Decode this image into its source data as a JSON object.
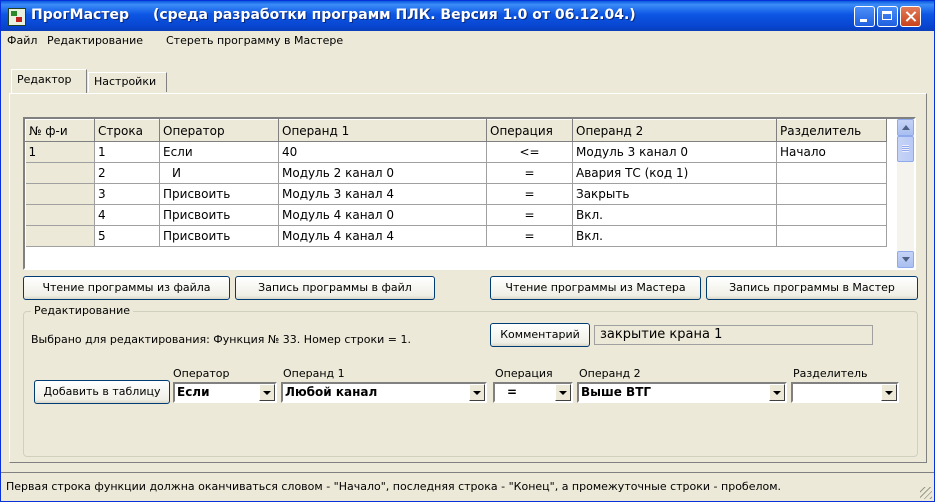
{
  "window": {
    "title": "ПрогМастер",
    "subtitle": "(среда разработки программ ПЛК.   Версия 1.0 от 06.12.04.)"
  },
  "menu": [
    "Файл",
    "Редактирование",
    "Стереть программу в Мастере"
  ],
  "tabs": [
    {
      "label": "Редактор",
      "active": true
    },
    {
      "label": "Настройки",
      "active": false
    }
  ],
  "table": {
    "columns": [
      "№ ф-и",
      "Строка",
      "Оператор",
      "Операнд 1",
      "Операция",
      "Операнд 2",
      "Разделитель"
    ],
    "rows": [
      [
        "1",
        "1",
        "Если",
        "40",
        "<=",
        "Модуль 3 канал 0",
        "Начало"
      ],
      [
        "",
        "2",
        "И",
        "Модуль 2 канал 0",
        "=",
        "Авария ТС (код 1)",
        ""
      ],
      [
        "",
        "3",
        "Присвоить",
        "Модуль 3 канал 4",
        "=",
        "Закрыть",
        ""
      ],
      [
        "",
        "4",
        "Присвоить",
        "Модуль 4 канал 0",
        "=",
        "Вкл.",
        ""
      ],
      [
        "",
        "5",
        "Присвоить",
        "Модуль 4 канал 4",
        "=",
        "Вкл.",
        ""
      ]
    ]
  },
  "buttons": {
    "read_file": "Чтение программы из файла",
    "write_file": "Запись программы в файл",
    "read_master": "Чтение программы из Мастера",
    "write_master": "Запись программы в Мастер",
    "comment": "Комментарий",
    "add_to_table": "Добавить в таблицу"
  },
  "editing": {
    "group_label": "Редактирование",
    "selected_info": "Выбрано для редактирования: Функция № 33. Номер строки = 1.",
    "comment_value": "закрытие крана 1",
    "labels": {
      "operator": "Оператор",
      "operand1": "Операнд 1",
      "operation": "Операция",
      "operand2": "Операнд 2",
      "separator": "Разделитель"
    },
    "values": {
      "operator": "Если",
      "operand1": "Любой канал",
      "operation": "=",
      "operand2": "Выше ВТГ",
      "separator": ""
    }
  },
  "status": "Первая строка функции должна оканчиваться словом - \"Начало\", последняя строка - \"Конец\", а промежуточные строки - пробелом."
}
